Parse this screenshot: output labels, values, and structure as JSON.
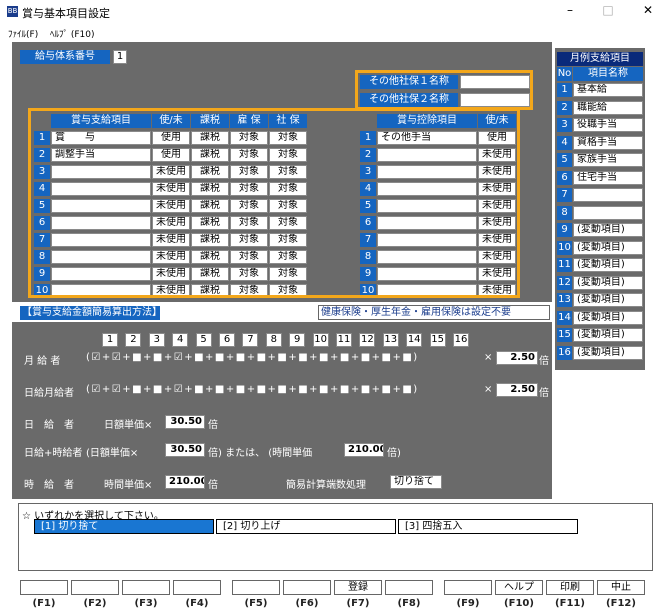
{
  "window": {
    "title": "賞与基本項目設定",
    "icon": "BB",
    "minimize": "–",
    "maximize": "□",
    "close": "✕"
  },
  "menu": {
    "file": "ﾌｧｲﾙ(F)",
    "help": "ﾍﾙﾌﾟ (F10)"
  },
  "pay_system": {
    "label": "給与体系番号",
    "value": "1"
  },
  "other_ins": {
    "label1": "その他社保１名称",
    "value1": "",
    "label2": "その他社保２名称",
    "value2": ""
  },
  "payments": {
    "headers": [
      "賞与支給項目",
      "使/未",
      "課税",
      "雇 保",
      "社 保"
    ],
    "rows": [
      {
        "no": "1",
        "name": "賞　　与",
        "use": "使用",
        "tax": "課税",
        "emp": "対象",
        "soc": "対象"
      },
      {
        "no": "2",
        "name": "調整手当",
        "use": "使用",
        "tax": "課税",
        "emp": "対象",
        "soc": "対象"
      },
      {
        "no": "3",
        "name": "",
        "use": "未使用",
        "tax": "課税",
        "emp": "対象",
        "soc": "対象"
      },
      {
        "no": "4",
        "name": "",
        "use": "未使用",
        "tax": "課税",
        "emp": "対象",
        "soc": "対象"
      },
      {
        "no": "5",
        "name": "",
        "use": "未使用",
        "tax": "課税",
        "emp": "対象",
        "soc": "対象"
      },
      {
        "no": "6",
        "name": "",
        "use": "未使用",
        "tax": "課税",
        "emp": "対象",
        "soc": "対象"
      },
      {
        "no": "7",
        "name": "",
        "use": "未使用",
        "tax": "課税",
        "emp": "対象",
        "soc": "対象"
      },
      {
        "no": "8",
        "name": "",
        "use": "未使用",
        "tax": "課税",
        "emp": "対象",
        "soc": "対象"
      },
      {
        "no": "9",
        "name": "",
        "use": "未使用",
        "tax": "課税",
        "emp": "対象",
        "soc": "対象"
      },
      {
        "no": "10",
        "name": "",
        "use": "未使用",
        "tax": "課税",
        "emp": "対象",
        "soc": "対象"
      }
    ]
  },
  "deductions": {
    "headers": [
      "賞与控除項目",
      "使/未"
    ],
    "rows": [
      {
        "no": "1",
        "name": "その他手当",
        "use": "使用"
      },
      {
        "no": "2",
        "name": "",
        "use": "未使用"
      },
      {
        "no": "3",
        "name": "",
        "use": "未使用"
      },
      {
        "no": "4",
        "name": "",
        "use": "未使用"
      },
      {
        "no": "5",
        "name": "",
        "use": "未使用"
      },
      {
        "no": "6",
        "name": "",
        "use": "未使用"
      },
      {
        "no": "7",
        "name": "",
        "use": "未使用"
      },
      {
        "no": "8",
        "name": "",
        "use": "未使用"
      },
      {
        "no": "9",
        "name": "",
        "use": "未使用"
      },
      {
        "no": "10",
        "name": "",
        "use": "未使用"
      }
    ]
  },
  "monthly": {
    "title": "月例支給項目",
    "headers": [
      "No",
      "項目名称"
    ],
    "rows": [
      {
        "no": "1",
        "name": "基本給"
      },
      {
        "no": "2",
        "name": "職能給"
      },
      {
        "no": "3",
        "name": "役職手当"
      },
      {
        "no": "4",
        "name": "資格手当"
      },
      {
        "no": "5",
        "name": "家族手当"
      },
      {
        "no": "6",
        "name": "住宅手当"
      },
      {
        "no": "7",
        "name": ""
      },
      {
        "no": "8",
        "name": ""
      },
      {
        "no": "9",
        "name": "(変動項目)"
      },
      {
        "no": "10",
        "name": "(変動項目)"
      },
      {
        "no": "11",
        "name": "(変動項目)"
      },
      {
        "no": "12",
        "name": "(変動項目)"
      },
      {
        "no": "13",
        "name": "(変動項目)"
      },
      {
        "no": "14",
        "name": "(変動項目)"
      },
      {
        "no": "15",
        "name": "(変動項目)"
      },
      {
        "no": "16",
        "name": "(変動項目)"
      }
    ]
  },
  "calc": {
    "section_title": "【賞与支給金額簡易算出方法】",
    "note": "健康保険・厚生年金・雇用保険は設定不要",
    "col_numbers": [
      "1",
      "2",
      "3",
      "4",
      "5",
      "6",
      "7",
      "8",
      "9",
      "10",
      "11",
      "12",
      "13",
      "14",
      "15",
      "16"
    ],
    "monthly_label": "月 給 者",
    "monthly_formula": "(☑+☑+■+■+☑+■+■+■+■+■+■+■+■+■+■+■)",
    "monthly_times": "×",
    "monthly_value": "2.50",
    "bai": "倍",
    "daily_monthly_label": "日給月給者",
    "daily_monthly_formula": "(☑+☑+■+■+☑+■+■+■+■+■+■+■+■+■+■+■)",
    "daily_monthly_value": "2.50",
    "daily_label": "日　給　者",
    "daily_text": "日額単価×",
    "daily_value": "30.50",
    "daily_hourly_label": "日給+時給者",
    "daily_hourly_text1": "(日額単価×",
    "daily_hourly_value1": "30.50",
    "daily_hourly_text2": "倍) または、 (時間単価",
    "daily_hourly_value2": "210.00",
    "daily_hourly_text3": "倍)",
    "hourly_label": "時　給　者",
    "hourly_text": "時間単価×",
    "hourly_value": "210.00",
    "rounding_label": "簡易計算端数処理",
    "rounding_value": "切り捨て"
  },
  "select": {
    "prompt": "☆ いずれかを選択して下さい。",
    "options": [
      "[1] 切り捨て",
      "[2] 切り上げ",
      "[3] 四捨五入"
    ]
  },
  "fkeys": {
    "labels": [
      "(F1)",
      "(F2)",
      "(F3)",
      "(F4)",
      "(F5)",
      "(F6)",
      "(F7)",
      "(F8)",
      "(F9)",
      "(F10)",
      "(F11)",
      "(F12)"
    ],
    "buttons": [
      "",
      "",
      "",
      "",
      "",
      "",
      "登録",
      "",
      "",
      "ヘルプ",
      "印刷",
      "中止"
    ]
  }
}
